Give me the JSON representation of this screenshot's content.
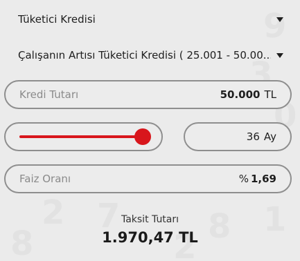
{
  "loan_type_select": {
    "value": "Tüketici Kredisi",
    "icon": "chevron-down-icon"
  },
  "product_select": {
    "value": "Çalışanın Artısı Tüketici Kredisi ( 25.001 - 50.00...",
    "icon": "chevron-down-icon"
  },
  "amount_field": {
    "label": "Kredi Tutarı",
    "value": "50.000",
    "unit": "TL"
  },
  "term_slider": {
    "level_fraction": 0.96,
    "accent_color": "#d8161c"
  },
  "term_field": {
    "value": "36",
    "unit": "Ay"
  },
  "rate_field": {
    "label": "Faiz Oranı",
    "prefix": "%",
    "value": "1,69"
  },
  "installment": {
    "label": "Taksit Tutarı",
    "value": "1.970,47 TL"
  },
  "bg_digits": [
    "9",
    "3",
    "0",
    "8",
    "7",
    "8",
    "1",
    "2",
    "2"
  ]
}
